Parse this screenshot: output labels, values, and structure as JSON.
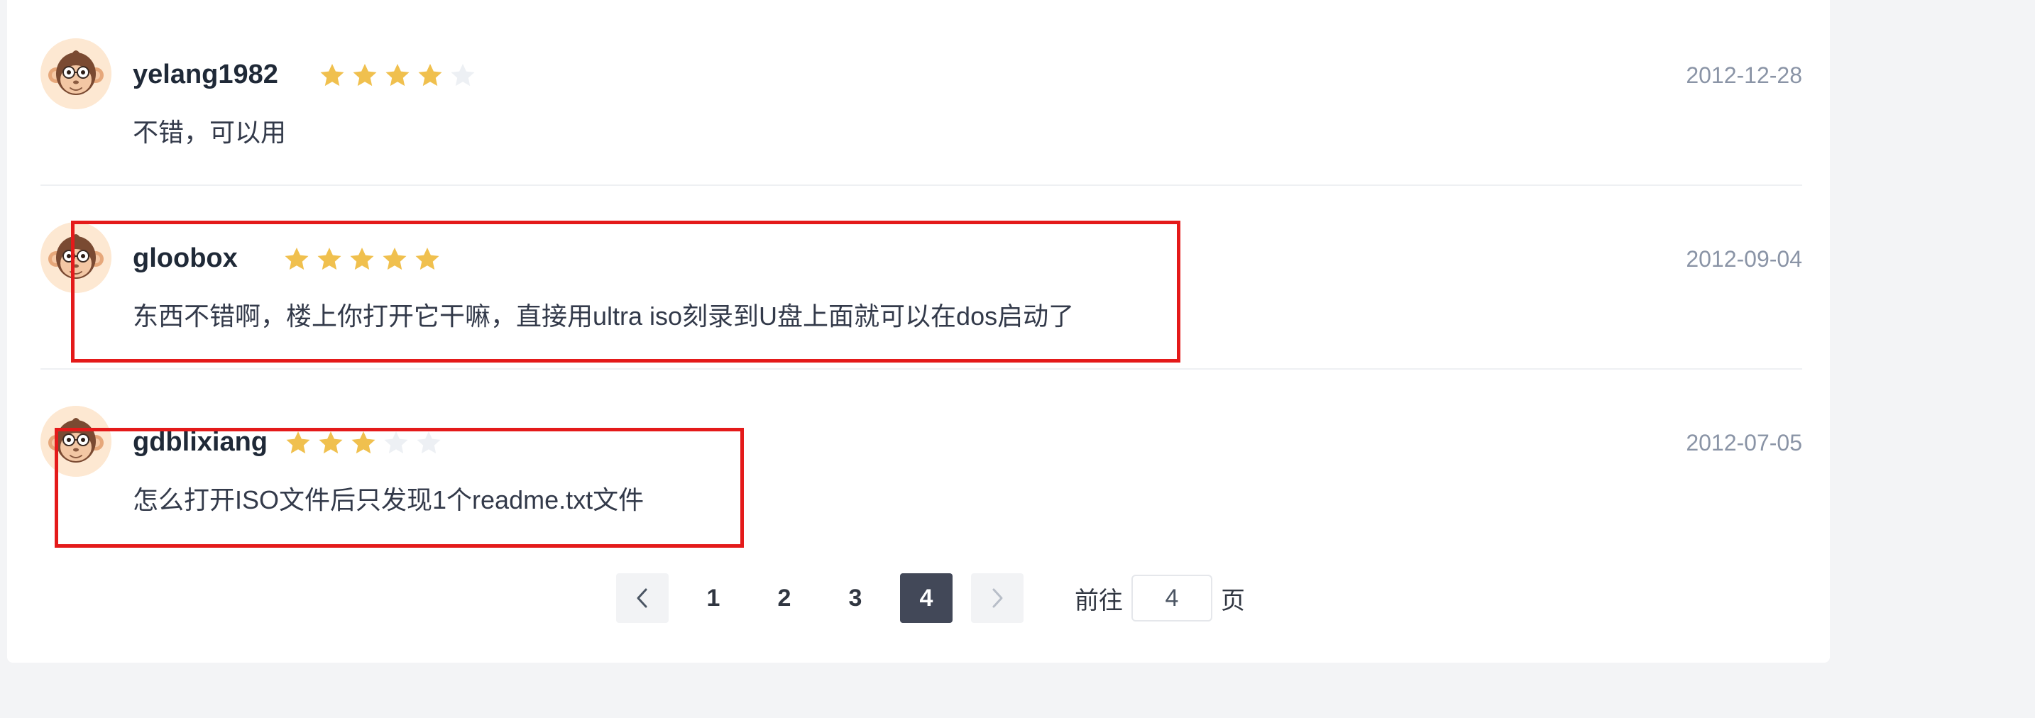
{
  "reviews": [
    {
      "username": "yelang1982",
      "rating": 4,
      "max_rating": 5,
      "date": "2012-12-28",
      "content": "不错，可以用",
      "avatar_icon": "monkey-avatar-icon"
    },
    {
      "username": "gloobox",
      "rating": 5,
      "max_rating": 5,
      "date": "2012-09-04",
      "content": "东西不错啊，楼上你打开它干嘛，直接用ultra iso刻录到U盘上面就可以在dos启动了",
      "avatar_icon": "monkey-avatar-icon"
    },
    {
      "username": "gdblixiang",
      "rating": 3,
      "max_rating": 5,
      "date": "2012-07-05",
      "content": "怎么打开ISO文件后只发现1个readme.txt文件",
      "avatar_icon": "monkey-avatar-icon"
    }
  ],
  "pagination": {
    "pages": [
      "1",
      "2",
      "3",
      "4"
    ],
    "current_page": "4",
    "goto_label": "前往",
    "goto_value": "4",
    "page_suffix": "页",
    "prev_icon": "chevron-left-icon",
    "next_icon": "chevron-right-icon"
  },
  "colors": {
    "star_filled": "#f0c04e",
    "star_empty": "#edf0f4",
    "highlight": "#e41a1a",
    "active_page": "#424858"
  }
}
